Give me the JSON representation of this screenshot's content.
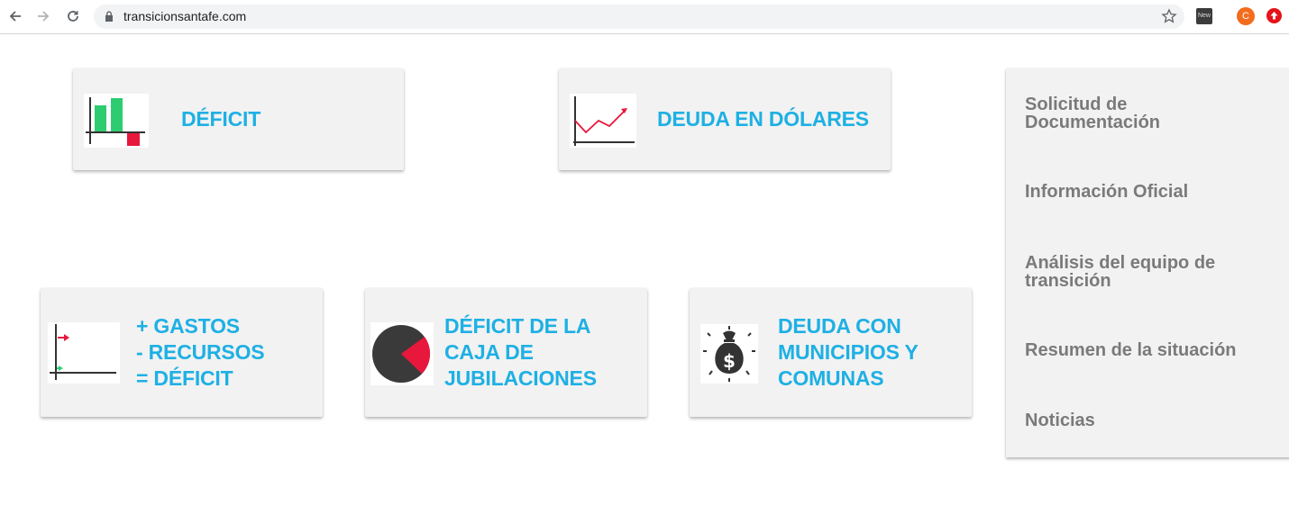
{
  "browser": {
    "url": "transicionsantafe.com",
    "extension_new_label": "New",
    "extension_c_label": "C"
  },
  "cards": {
    "deficit": {
      "title": "DÉFICIT",
      "icon": "bar-chart-icon"
    },
    "deuda_dolares": {
      "title": "DEUDA EN DÓLARES",
      "icon": "line-chart-up-icon"
    },
    "gastos": {
      "line1": "+ GASTOS",
      "line2": "- RECURSOS",
      "line3": "= DÉFICIT",
      "icon": "axis-arrows-icon"
    },
    "jubilaciones": {
      "line1": "DÉFICIT DE LA",
      "line2": "CAJA DE",
      "line3": "JUBILACIONES",
      "icon": "pie-chart-icon"
    },
    "municipios": {
      "line1": "DEUDA CON",
      "line2": "MUNICIPIOS Y",
      "line3": "COMUNAS",
      "icon": "money-bag-icon"
    }
  },
  "side_menu": {
    "items": [
      {
        "line1": "Solicitud de",
        "line2": "Documentación"
      },
      {
        "line1": "Información Oficial"
      },
      {
        "line1": "Análisis del equipo de",
        "line2": "transición"
      },
      {
        "line1": "Resumen de la situación"
      },
      {
        "line1": "Noticias"
      }
    ]
  },
  "colors": {
    "accent": "#1eb0e4",
    "card_bg": "#f2f2f2",
    "menu_text": "#7a7a7a",
    "green": "#2ecc71",
    "red": "#e8173c"
  }
}
